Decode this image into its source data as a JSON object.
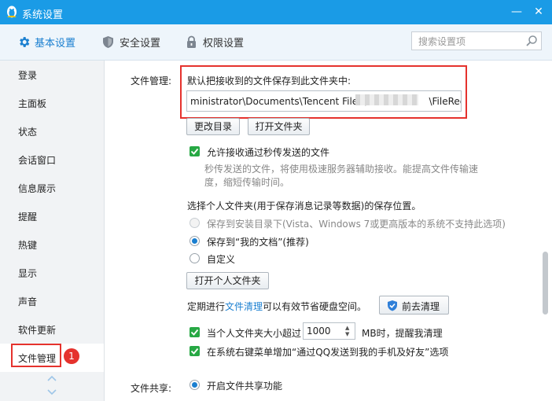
{
  "window": {
    "title": "系统设置",
    "minimize": "—",
    "close": "✕"
  },
  "tabs": [
    {
      "label": "基本设置",
      "icon": "gear-icon",
      "active": true
    },
    {
      "label": "安全设置",
      "icon": "shield-icon",
      "active": false
    },
    {
      "label": "权限设置",
      "icon": "lock-icon",
      "active": false
    }
  ],
  "search": {
    "placeholder": "搜索设置项"
  },
  "sidebar": {
    "items": [
      "登录",
      "主面板",
      "状态",
      "会话窗口",
      "信息展示",
      "提醒",
      "热键",
      "显示",
      "声音",
      "软件更新",
      "文件管理"
    ],
    "active_index": 10,
    "badge": "1"
  },
  "file_management": {
    "section_label": "文件管理:",
    "save_desc": "默认把接收到的文件保存到此文件夹中:",
    "path_start": "ministrator\\Documents\\Tencent Files\\",
    "path_end": "\\FileRecv\\",
    "change_dir_button": "更改目录",
    "open_folder_button": "打开文件夹",
    "allow_quick_send": "允许接收通过秒传发送的文件",
    "quick_send_note_1": "秒传发送的文件，将使用极速服务器辅助接收。能提高文件传输速",
    "quick_send_note_2": "度，缩短传输时间。",
    "personal_folder_desc": "选择个人文件夹(用于保存消息记录等数据)的保存位置。",
    "radio_install_dir": "保存到安装目录下(Vista、Windows 7或更高版本的系统不支持此选项)",
    "radio_my_docs": "保存到“我的文档”(推荐)",
    "radio_custom": "自定义",
    "open_personal_folder_button": "打开个人文件夹",
    "cleanup_prefix": "定期进行",
    "cleanup_link": "文件清理",
    "cleanup_suffix": "可以有效节省硬盘空间。",
    "cleanup_button": "前去清理",
    "size_prefix": "当个人文件夹大小超过",
    "size_value": "1000",
    "size_suffix": "MB时，提醒我清理",
    "context_menu_option": "在系统右键菜单增加“通过QQ发送到我的手机及好友”选项"
  },
  "file_sharing": {
    "section_label": "文件共享:",
    "enable_sharing": "开启文件共享功能"
  },
  "colors": {
    "accent": "#1a9be6",
    "highlight": "#e5322d",
    "check": "#27a844"
  }
}
